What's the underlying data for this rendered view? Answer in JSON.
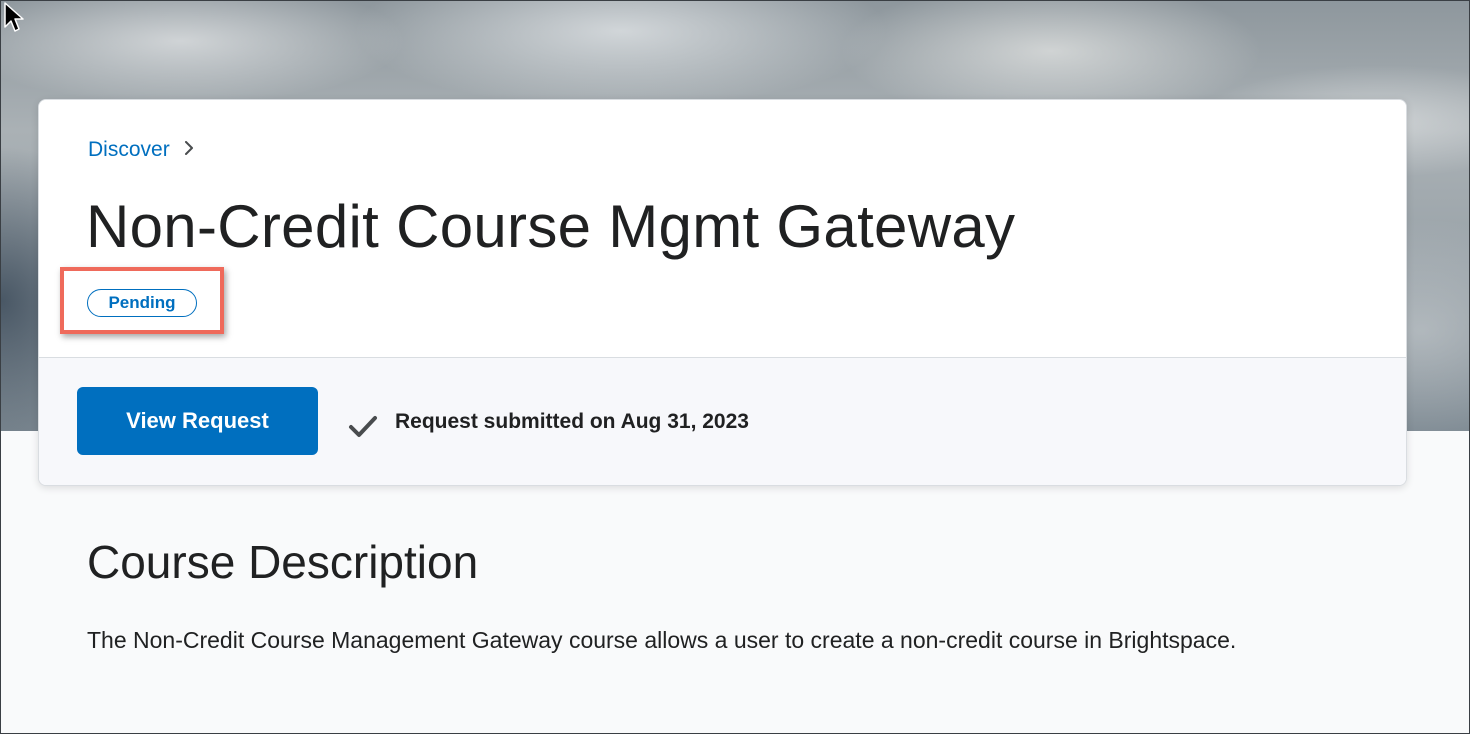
{
  "breadcrumb": {
    "parent_label": "Discover"
  },
  "course": {
    "title": "Non-Credit Course Mgmt Gateway",
    "status_badge": "Pending"
  },
  "actions": {
    "view_request_label": "View Request",
    "status_text": "Request submitted on Aug 31, 2023"
  },
  "description": {
    "heading": "Course Description",
    "body": "The Non-Credit Course Management Gateway course allows a user to create a non-credit course in Brightspace."
  },
  "colors": {
    "primary": "#006fbf",
    "highlight": "#ef6a5b",
    "text": "#202122"
  },
  "icons": [
    "mouse-cursor-icon",
    "chevron-right-icon",
    "check-icon"
  ]
}
